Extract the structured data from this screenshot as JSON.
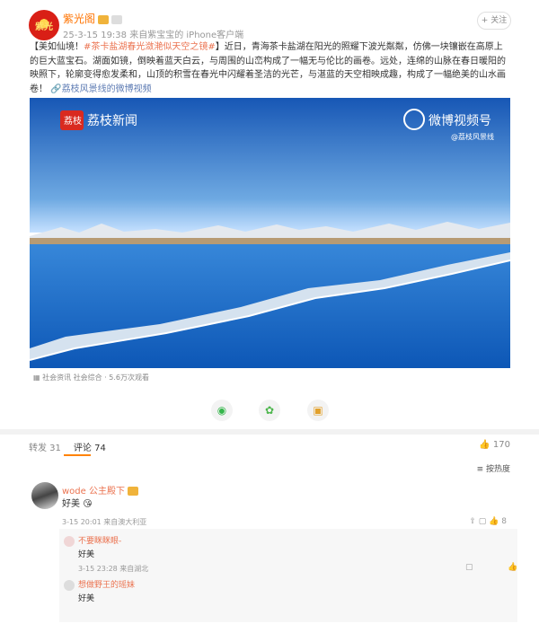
{
  "post": {
    "avatar_text": "紫光",
    "user_name": "紫光阁",
    "meta": "25-3-15 19:38  来自紫宝宝的 iPhone客户端",
    "follow_label": "+ 关注",
    "text_prefix": "【美如仙境！",
    "topic": "#茶卡盐湖春光潋滟似天空之镜#",
    "text_body": "】近日，青海茶卡盐湖在阳光的照耀下波光粼粼，仿佛一块镶嵌在高原上的巨大蓝宝石。湖面如镜，倒映着蓝天白云，与周围的山峦构成了一幅无与伦比的画卷。远处，连绵的山脉在春日暖阳的映照下，轮廓变得愈发柔和，山顶的积雪在春光中闪耀着圣洁的光芒，与湛蓝的天空相映成趣，构成了一幅绝美的山水画卷！",
    "link_text": "荔枝风景线的微博视频",
    "video": {
      "left_logo_badge": "荔枝",
      "left_logo_text": "荔枝新闻",
      "right_logo_text": "微博视频号",
      "right_handle": "@荔枝风景线"
    },
    "video_caption": "社会资讯 社会综合 · 5.6万次观看"
  },
  "comments_section": {
    "repost_tab": "转发 31",
    "comment_tab": "评论 74",
    "like_count": "170",
    "sort_label": "按热度",
    "comment": {
      "user": "wode 公主殿下",
      "text": "好美",
      "meta": "3-15 20:01 来自澳大利亚",
      "likes": "8"
    },
    "replies": [
      {
        "user": "不要眯眯眼-",
        "text": "好美",
        "meta": "3-15 23:28 来自湖北"
      },
      {
        "user": "想做野王的瑶妹",
        "text": "好美",
        "meta": ""
      }
    ]
  },
  "colors": {
    "accent": "#ff8200",
    "topic": "#eb7350",
    "link": "#5d7bb3"
  }
}
